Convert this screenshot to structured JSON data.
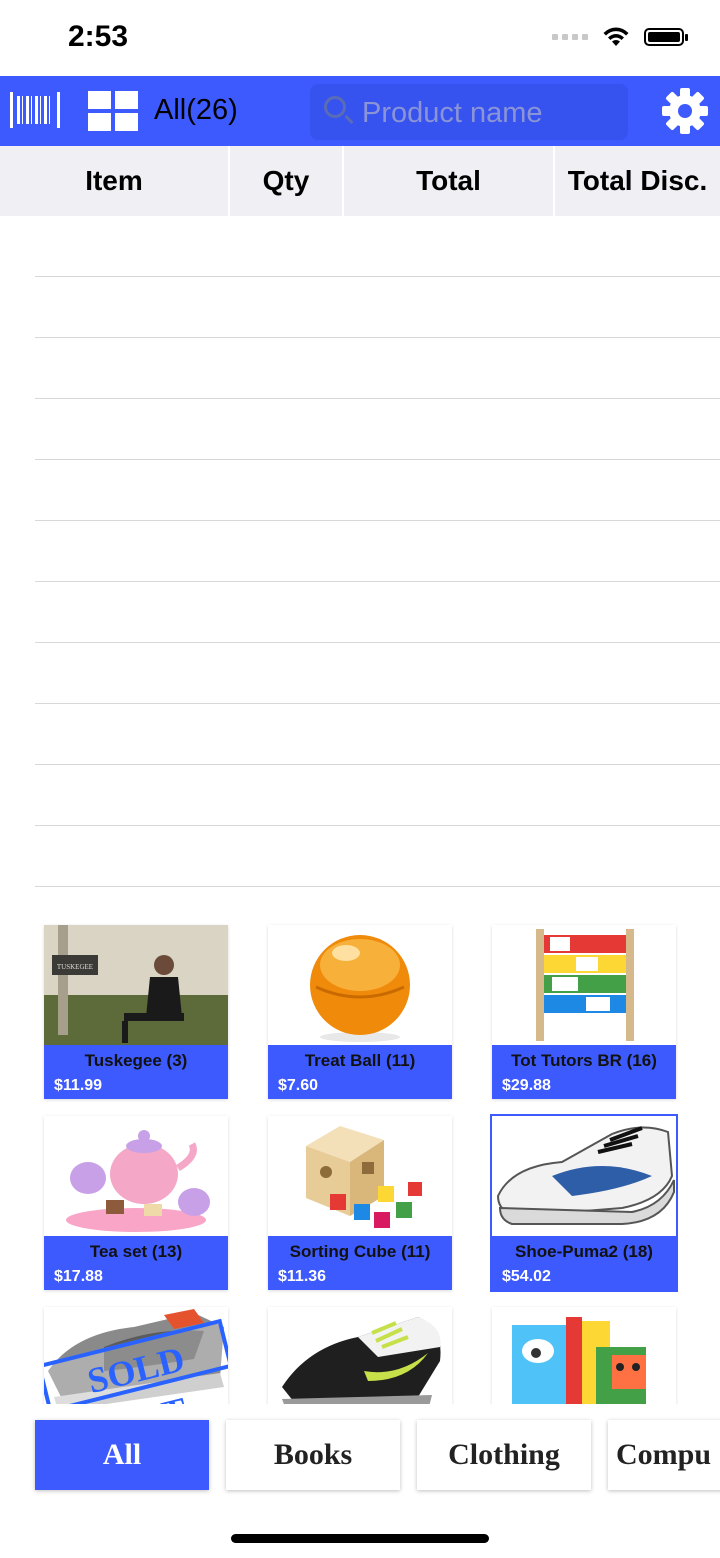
{
  "status_bar": {
    "time": "2:53"
  },
  "toolbar": {
    "category_label": "All(26)",
    "search_placeholder": "Product name"
  },
  "order_table": {
    "columns": [
      "Item",
      "Qty",
      "Total",
      "Total Disc."
    ],
    "rows": []
  },
  "products": [
    {
      "name": "Tuskegee (3)",
      "price": "$11.99",
      "image": "album-cover-image"
    },
    {
      "name": "Treat Ball (11)",
      "price": "$7.60",
      "image": "orange-ball-image"
    },
    {
      "name": "Tot Tutors BR (16)",
      "price": "$29.88",
      "image": "bookshelf-image"
    },
    {
      "name": "Tea set (13)",
      "price": "$17.88",
      "image": "tea-set-image"
    },
    {
      "name": "Sorting Cube (11)",
      "price": "$11.36",
      "image": "sorting-cube-image"
    },
    {
      "name": "Shoe-Puma2 (18)",
      "price": "$54.02",
      "image": "puma-shoe-image"
    },
    {
      "name": "",
      "price": "",
      "image": "sneaker-image",
      "badge": "SOLD OUT"
    },
    {
      "name": "",
      "price": "",
      "image": "nike-shoe-image"
    },
    {
      "name": "",
      "price": "",
      "image": "baby-blocks-image"
    }
  ],
  "category_tabs": [
    "All",
    "Books",
    "Clothing",
    "Compu"
  ],
  "colors": {
    "accent": "#3d5afe",
    "header_bg": "#efeff4"
  }
}
